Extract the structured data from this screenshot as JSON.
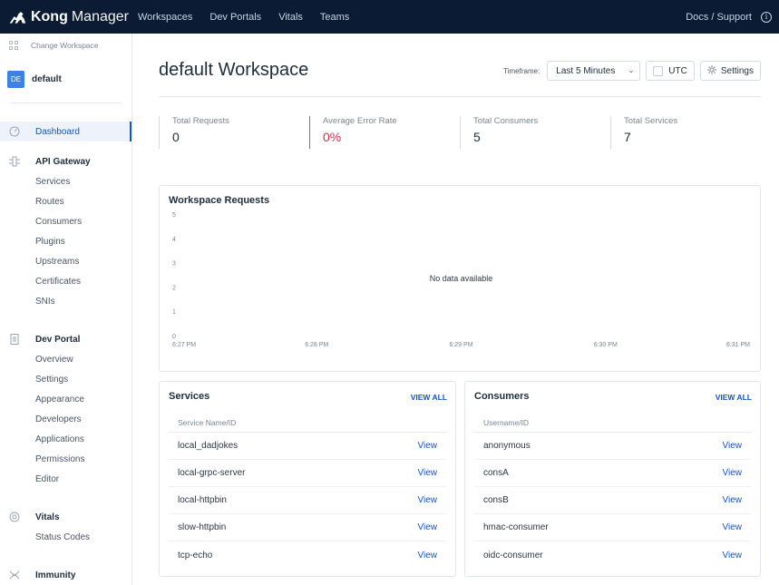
{
  "app": {
    "brand": "Kong",
    "brand_suffix": "Manager",
    "nav": [
      "Workspaces",
      "Dev Portals",
      "Vitals",
      "Teams"
    ],
    "docs_link": "Docs / Support"
  },
  "sidebar": {
    "change_workspace": "Change Workspace",
    "workspace_badge": "DE",
    "workspace_name": "default",
    "dashboard": "Dashboard",
    "api_gateway": {
      "title": "API Gateway",
      "items": [
        "Services",
        "Routes",
        "Consumers",
        "Plugins",
        "Upstreams",
        "Certificates",
        "SNIs"
      ]
    },
    "dev_portal": {
      "title": "Dev Portal",
      "items": [
        "Overview",
        "Settings",
        "Appearance",
        "Developers",
        "Applications",
        "Permissions",
        "Editor"
      ]
    },
    "vitals": {
      "title": "Vitals",
      "items": [
        "Status Codes"
      ]
    },
    "immunity": {
      "title": "Immunity"
    }
  },
  "main": {
    "title": "default Workspace",
    "timeframe_label": "Timeframe:",
    "timeframe_value": "Last 5 Minutes",
    "utc_label": "UTC",
    "settings_label": "Settings",
    "stats": [
      {
        "label": "Total Requests",
        "value": "0"
      },
      {
        "label": "Average Error Rate",
        "value": "0%"
      },
      {
        "label": "Total Consumers",
        "value": "5"
      },
      {
        "label": "Total Services",
        "value": "7"
      }
    ],
    "services": {
      "title": "Services",
      "view_all": "VIEW ALL",
      "column": "Service Name/ID",
      "view_label": "View",
      "rows": [
        "local_dadjokes",
        "local-grpc-server",
        "local-httpbin",
        "slow-httpbin",
        "tcp-echo"
      ]
    },
    "consumers": {
      "title": "Consumers",
      "view_all": "VIEW ALL",
      "column": "Username/ID",
      "view_label": "View",
      "rows": [
        "anonymous",
        "consA",
        "consB",
        "hmac-consumer",
        "oidc-consumer"
      ]
    }
  },
  "colors": {
    "topbar": "#0b1b33",
    "accent": "#1155cb",
    "error": "#d6304a",
    "workspace_badge": "#3c82e3"
  },
  "chart_data": {
    "type": "line",
    "title": "Workspace Requests",
    "empty_message": "No data available",
    "x_ticks": [
      "6:27 PM",
      "6:28 PM",
      "6:29 PM",
      "6:30 PM",
      "6:31 PM"
    ],
    "y_ticks": [
      "0",
      "1",
      "2",
      "3",
      "4",
      "5"
    ],
    "ylim": [
      0,
      5
    ],
    "series": []
  }
}
